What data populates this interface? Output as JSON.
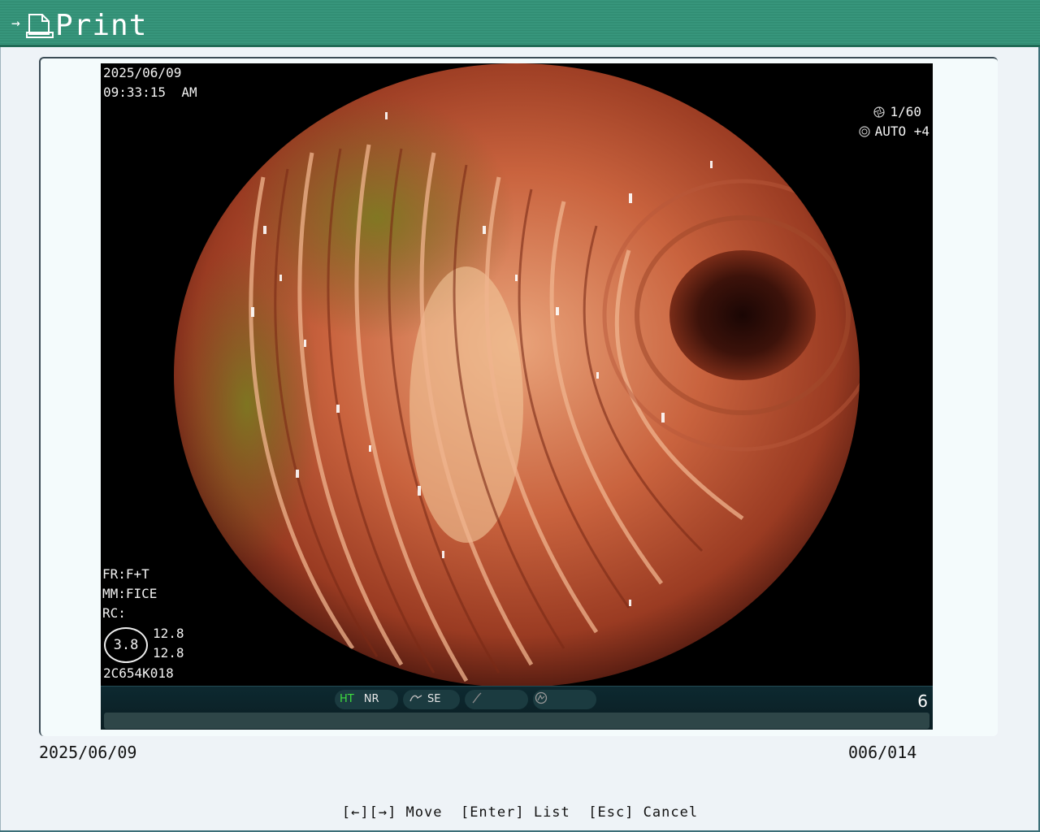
{
  "header": {
    "title": "Print",
    "arrow_icon": "→",
    "icon": "document-icon"
  },
  "image": {
    "date": "2025/06/09",
    "time": "09:33:15  AM",
    "shutter": "1/60",
    "exposure": "AUTO +4",
    "fr": "FR:F+T",
    "mm": "MM:FICE",
    "rc": "RC:",
    "circle_value": "3.8",
    "value_a": "12.8",
    "value_b": "12.8",
    "scope_id": "2C654K018",
    "status": {
      "ht": "HT",
      "nr": "NR",
      "se": "SE",
      "page": "6"
    }
  },
  "footer": {
    "date": "2025/06/09",
    "counter": "006/014",
    "keys": "[←][→] Move  [Enter] List  [Esc] Cancel"
  }
}
